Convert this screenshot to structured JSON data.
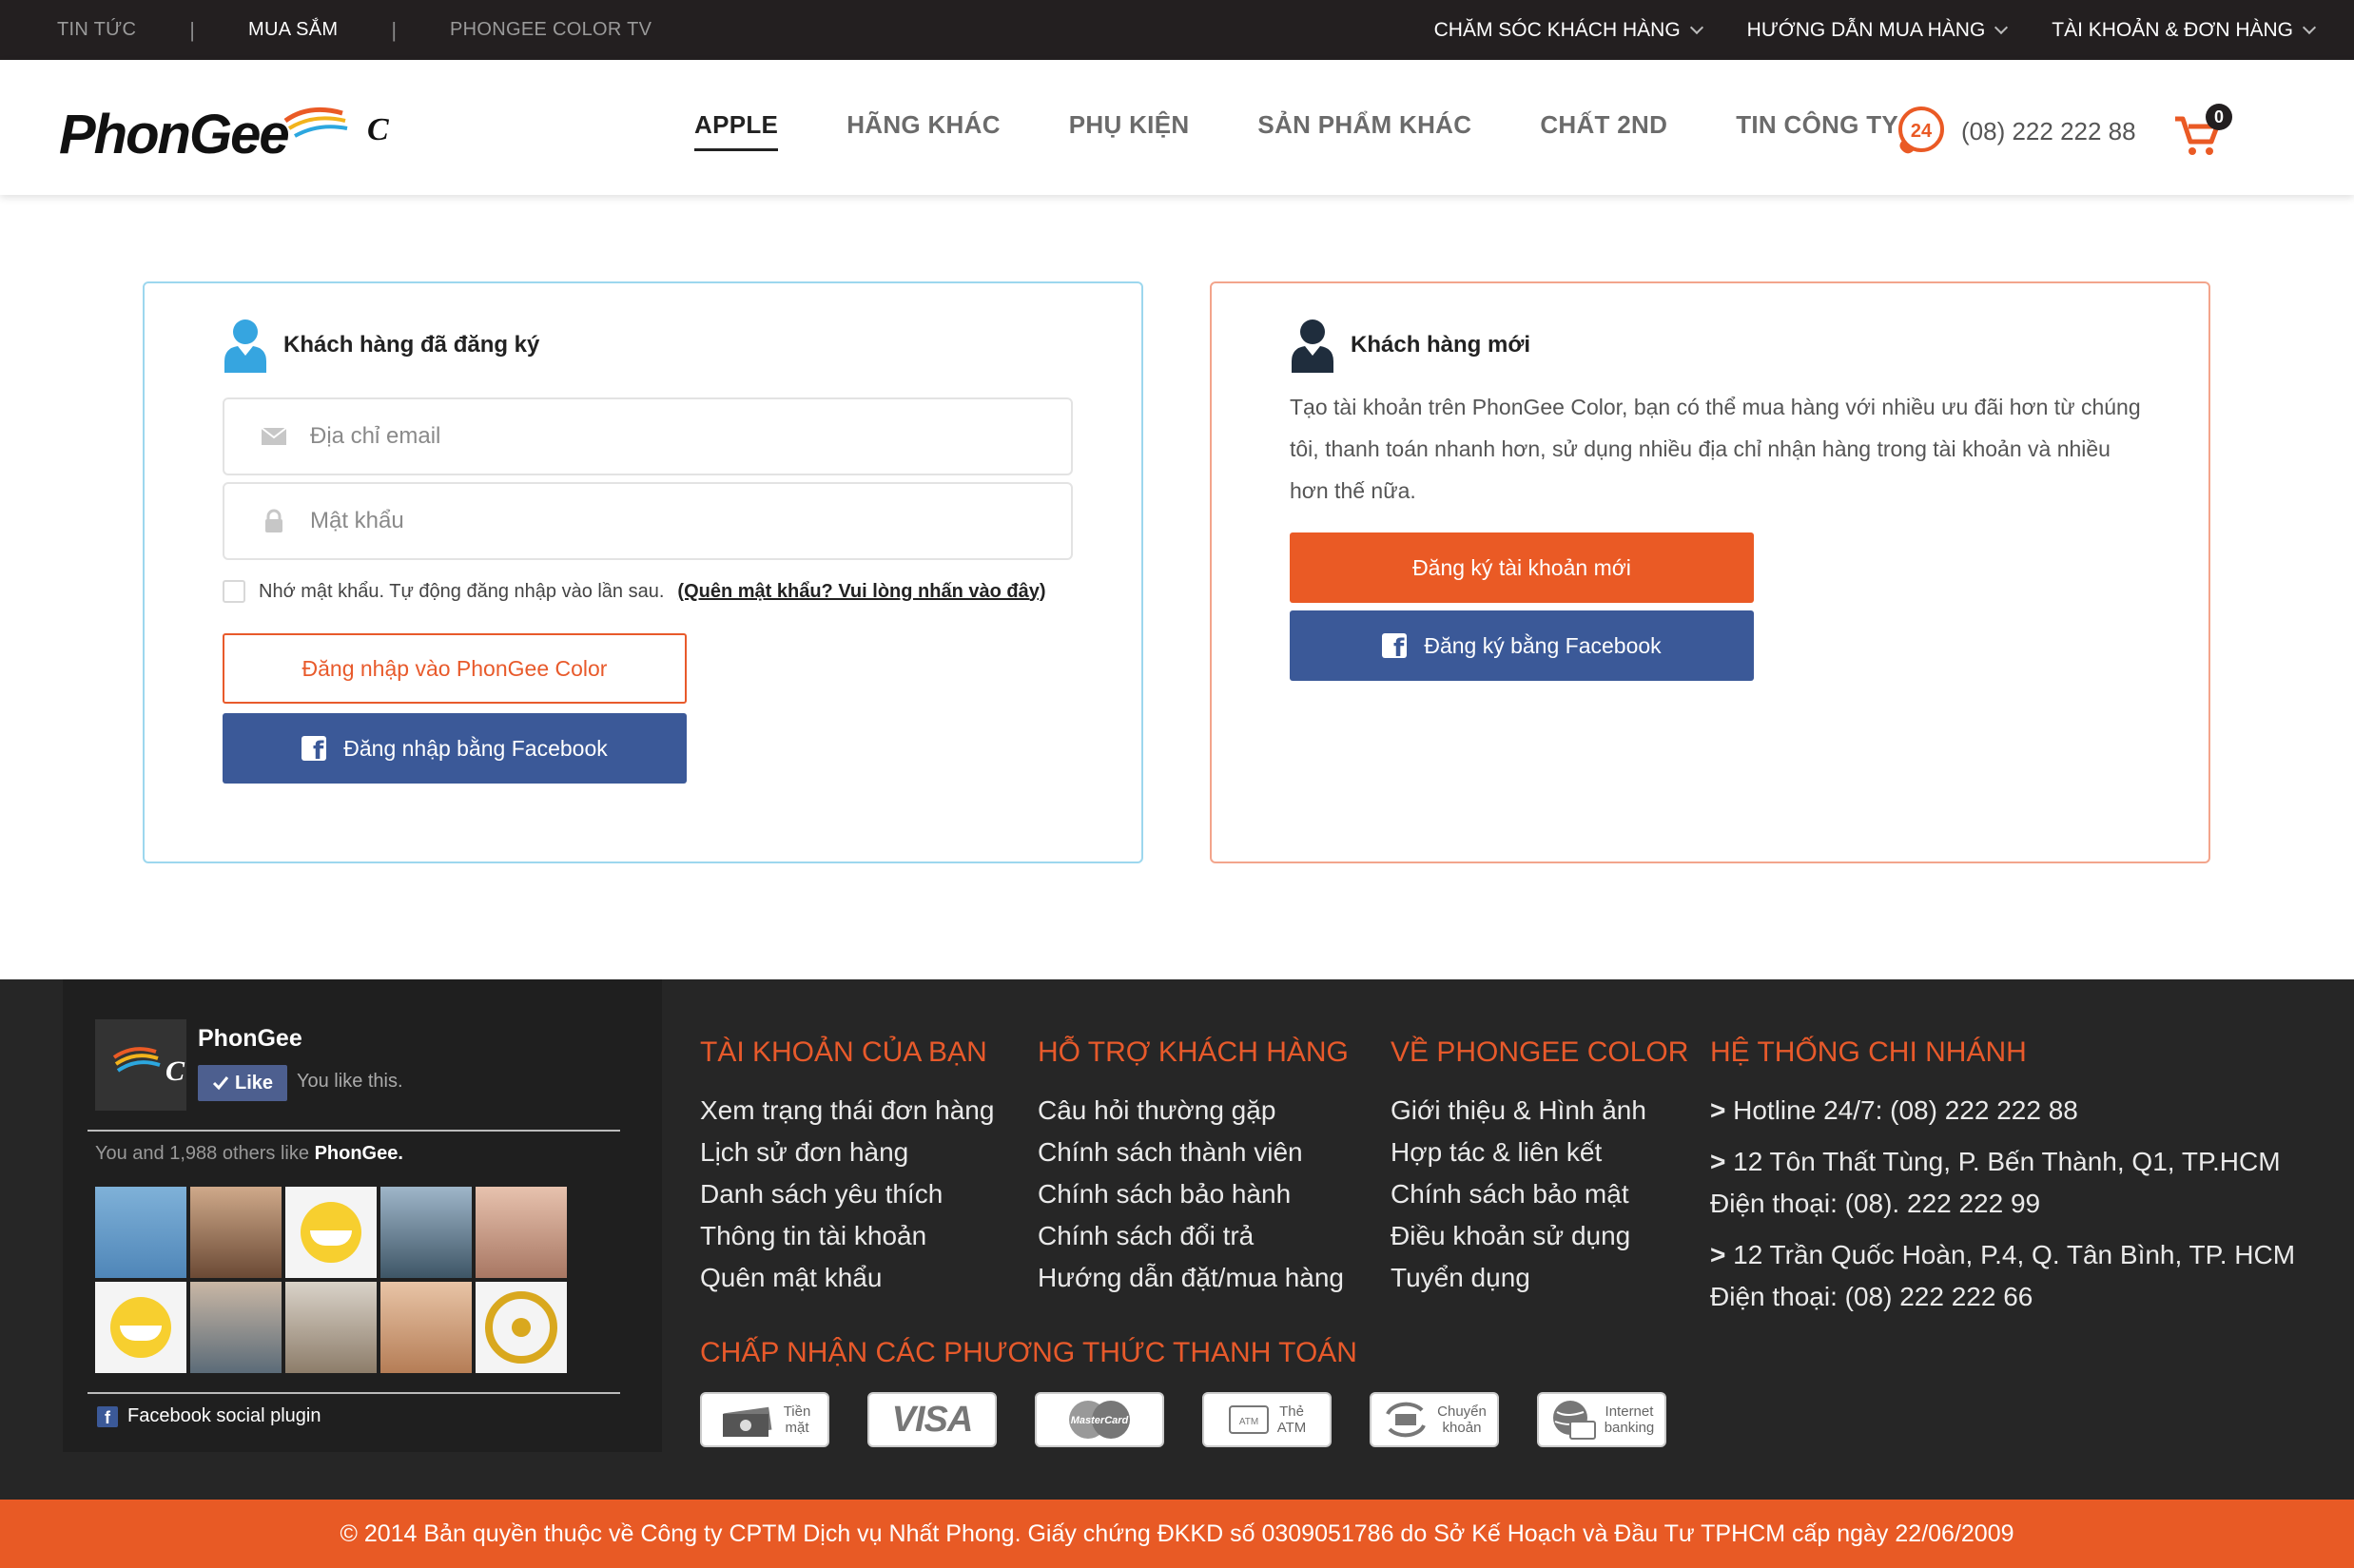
{
  "topbar": {
    "left": [
      "TIN TỨC",
      "MUA SẮM",
      "PHONGEE COLOR TV"
    ],
    "right": [
      "CHĂM SÓC KHÁCH HÀNG",
      "HƯỚNG DẪN MUA HÀNG",
      "TÀI KHOẢN & ĐƠN HÀNG"
    ]
  },
  "header": {
    "logo_text": "PhonGee",
    "logo_badge": "C",
    "nav": [
      "APPLE",
      "HÃNG KHÁC",
      "PHỤ KIỆN",
      "SẢN PHẨM KHÁC",
      "CHẤT 2ND",
      "TIN CÔNG TY"
    ],
    "hotline_badge": "24",
    "hotline": "(08) 222 222 88",
    "cart_count": "0"
  },
  "login": {
    "title": "Khách hàng đã đăng ký",
    "email_placeholder": "Địa chỉ email",
    "password_placeholder": "Mật khẩu",
    "remember_text": "Nhớ mật khẩu. Tự động đăng nhập vào lần sau.",
    "forgot_text": "(Quên mật khẩu? Vui lòng nhấn vào đây)",
    "login_button": "Đăng nhập vào PhonGee Color",
    "facebook_button": "Đăng nhập bằng Facebook"
  },
  "register": {
    "title": "Khách hàng mới",
    "description": "Tạo tài khoản trên PhonGee Color, bạn có thể mua hàng với nhiều ưu đãi hơn từ chúng tôi, thanh toán nhanh hơn, sử dụng nhiều địa chỉ nhận hàng trong tài khoản và nhiều hơn thế nữa.",
    "register_button": "Đăng ký tài khoản mới",
    "facebook_button": "Đăng ký bằng Facebook"
  },
  "facebook_widget": {
    "page_name": "PhonGee",
    "like_label": "Like",
    "liked_text": "You like this.",
    "others_prefix": "You and 1,988 others like",
    "others_page": "PhonGee.",
    "plugin_label": "Facebook social plugin"
  },
  "footer": {
    "account": {
      "title": "TÀI KHOẢN CỦA BẠN",
      "items": [
        "Xem trạng thái đơn hàng",
        "Lịch sử đơn hàng",
        "Danh sách yêu thích",
        "Thông tin tài khoản",
        "Quên mật khẩu"
      ]
    },
    "support": {
      "title": "HỖ TRỢ KHÁCH HÀNG",
      "items": [
        "Câu hỏi thường gặp",
        "Chính sách thành viên",
        "Chính sách bảo hành",
        "Chính sách đổi trả",
        "Hướng dẫn đặt/mua hàng"
      ]
    },
    "about": {
      "title": "VỀ PHONGEE COLOR",
      "items": [
        "Giới thiệu & Hình ảnh",
        "Hợp tác & liên kết",
        "Chính sách bảo mật",
        "Điều khoản sử dụng",
        "Tuyển dụng"
      ]
    },
    "branches": {
      "title": "HỆ THỐNG CHI NHÁNH",
      "hotline": "Hotline 24/7:  (08) 222 222 88",
      "branch1_address": "12 Tôn Thất Tùng, P. Bến Thành, Q1, TP.HCM",
      "branch1_phone": "Điện thoại: (08). 222 222 99",
      "branch2_address": "12 Trần Quốc Hoàn, P.4, Q. Tân Bình, TP. HCM",
      "branch2_phone": "Điện thoại: (08) 222 222 66"
    },
    "payment_title": "CHẤP NHẬN CÁC PHƯƠNG THỨC THANH TOÁN",
    "payments": {
      "cash": [
        "Tiền",
        "mặt"
      ],
      "visa": "VISA",
      "mastercard": "MasterCard",
      "atm_chip": "ATM",
      "atm": [
        "Thẻ",
        "ATM"
      ],
      "transfer": [
        "Chuyển",
        "khoản"
      ],
      "internet": [
        "Internet",
        "banking"
      ]
    }
  },
  "copyright": "© 2014 Bản quyền thuộc về Công ty CPTM Dịch vụ Nhất Phong. Giấy chứng ĐKKD số 0309051786 do Sở Kế Hoạch và Đầu Tư TPHCM cấp ngày 22/06/2009",
  "colors": {
    "accent": "#e85a25",
    "facebook": "#3b5998",
    "topbar": "#231f20",
    "footer": "#262626",
    "login_border": "#9dd7ee",
    "register_border": "#f3a58c"
  },
  "icons": {
    "user": "user-icon",
    "email": "envelope-icon",
    "password": "lock-icon",
    "hotline": "phone-24-icon",
    "cart": "cart-icon",
    "facebook": "facebook-icon"
  }
}
